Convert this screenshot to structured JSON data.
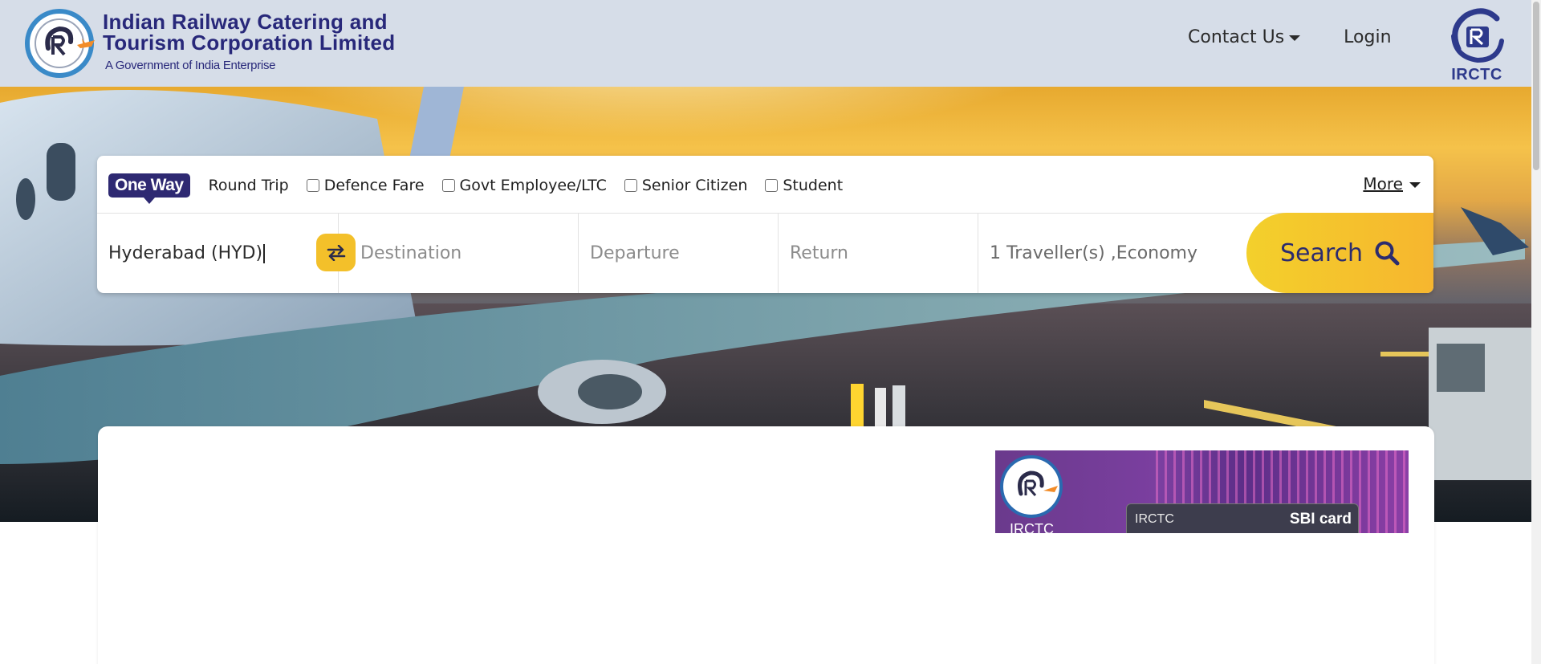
{
  "header": {
    "brand_line1": "Indian  Railway  Catering  and",
    "brand_line2": "Tourism Corporation Limited",
    "brand_line3": "A Government of India Enterprise",
    "nav": {
      "contact_label": "Contact Us",
      "login_label": "Login"
    },
    "corner_logo_label": "IRCTC"
  },
  "search": {
    "trip_types": {
      "one_way": "One Way",
      "round_trip": "Round Trip"
    },
    "fare_options": [
      {
        "label": "Defence Fare",
        "checked": false
      },
      {
        "label": "Govt Employee/LTC",
        "checked": false
      },
      {
        "label": "Senior Citizen",
        "checked": false
      },
      {
        "label": "Student",
        "checked": false
      }
    ],
    "more_label": "More",
    "origin_value": "Hyderabad (HYD)",
    "destination_placeholder": "Destination",
    "departure_placeholder": "Departure",
    "return_placeholder": "Return",
    "travellers_value": "1 Traveller(s) ,Economy",
    "search_label": "Search"
  },
  "ad": {
    "logo_text": "IRCTC",
    "card_text": "IRCTC",
    "card_brand": "SBI card"
  },
  "colors": {
    "brand_navy": "#2e2972",
    "accent_yellow": "#f5c02d",
    "header_bg": "#d6dde8"
  },
  "icons": [
    "irctc-logo-icon",
    "caret-down-icon",
    "swap-icon",
    "search-icon"
  ]
}
